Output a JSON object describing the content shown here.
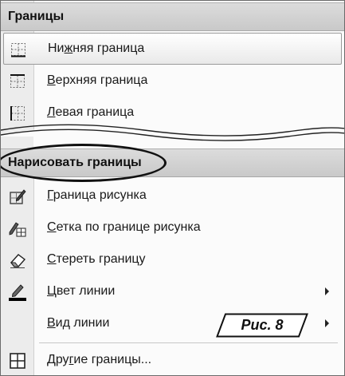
{
  "menu": {
    "borders_header": "Границы",
    "borders_items": [
      {
        "icon": "bottom-border-icon",
        "pre": "Ни",
        "key": "ж",
        "post": "няя граница"
      },
      {
        "icon": "top-border-icon",
        "pre": "",
        "key": "В",
        "post": "ерхняя граница"
      },
      {
        "icon": "left-border-icon",
        "pre": "",
        "key": "Л",
        "post": "евая граница"
      }
    ],
    "draw_header": "Нарисовать границы",
    "draw_items": [
      {
        "icon": "draw-border-icon",
        "pre": "",
        "key": "Г",
        "post": "раница рисунка"
      },
      {
        "icon": "draw-grid-icon",
        "pre": "",
        "key": "С",
        "post": "етка по границе рисунка"
      },
      {
        "icon": "eraser-icon",
        "pre": "",
        "key": "С",
        "post": "тереть границу"
      },
      {
        "icon": "pencil-line-color-icon",
        "pre": "",
        "key": "Ц",
        "post": "вет линии",
        "submenu": true
      },
      {
        "icon": "",
        "pre": "",
        "key": "В",
        "post": "ид линии",
        "submenu": true
      }
    ],
    "more_item": {
      "icon": "all-borders-icon",
      "pre": "Дру",
      "key": "г",
      "post": "ие границы..."
    }
  },
  "caption": "Рис. 8",
  "colors": {
    "accent_line": "#000000",
    "header_bg": "#d0d0d0"
  }
}
